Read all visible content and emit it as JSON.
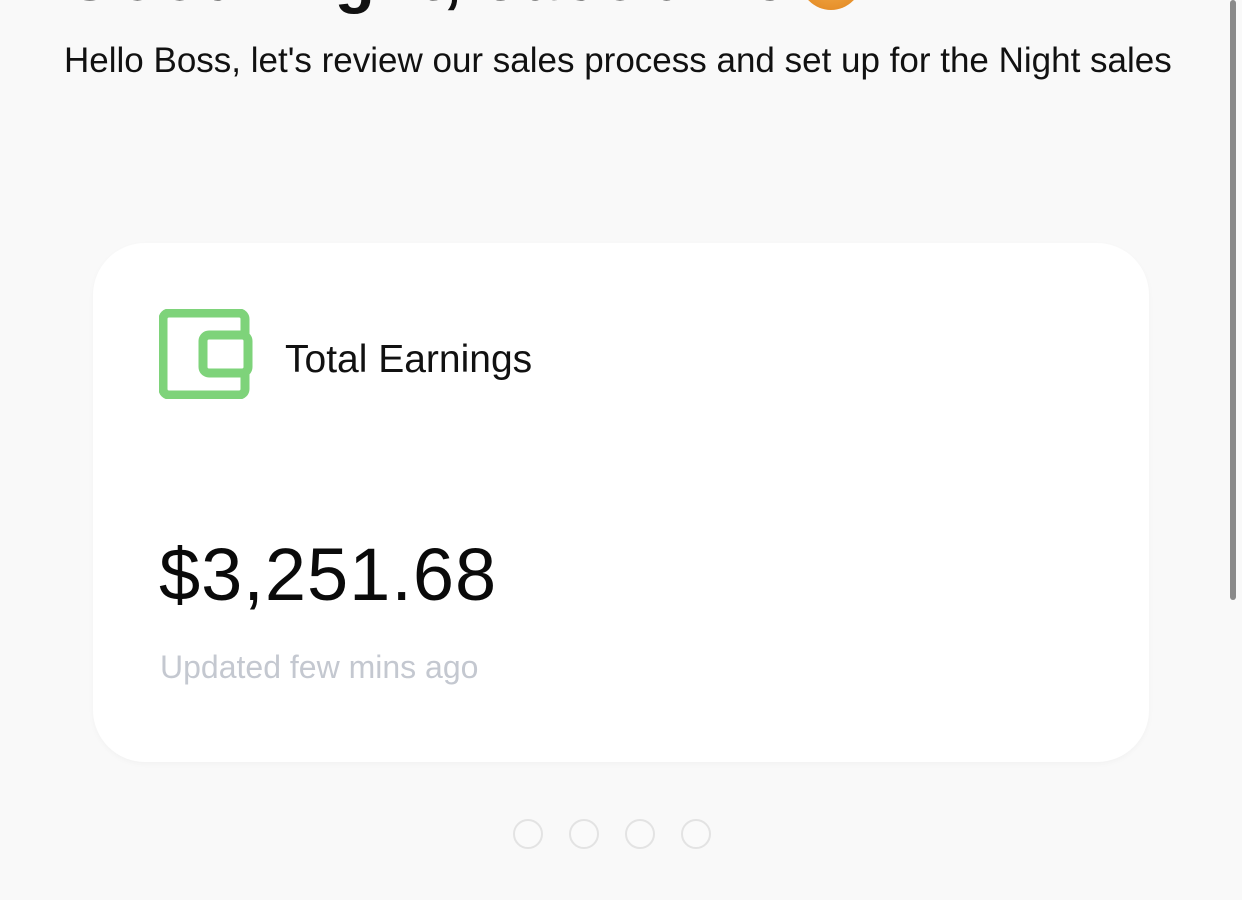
{
  "header": {
    "greeting_clipped": "Good Night, Jacob Pel",
    "subtitle": "Hello Boss, let's review our sales process and set up for the Night sales"
  },
  "earnings_card": {
    "icon": "wallet-icon",
    "title": "Total Earnings",
    "amount": "$3,251.68",
    "updated": "Updated few mins ago",
    "accent_color": "#7ed37a"
  },
  "carousel": {
    "page_count": 4,
    "active_index": 0
  },
  "colors": {
    "background": "#f9f9f9",
    "card_background": "#ffffff",
    "muted_text": "#c4c8d0",
    "icon_green": "#7ed37a"
  }
}
